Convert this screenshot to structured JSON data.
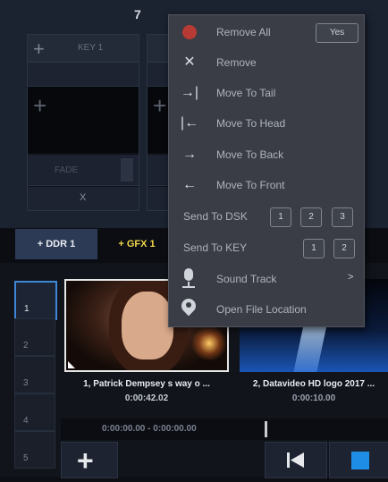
{
  "top": {
    "number": "7",
    "key_label": "KEY 1",
    "fade_label": "FADE",
    "x_label": "X"
  },
  "tabs": [
    {
      "label": "+ DDR 1"
    },
    {
      "label": "+ GFX 1"
    }
  ],
  "menu": {
    "remove_all": "Remove All",
    "yes": "Yes",
    "remove": "Remove",
    "move_to_tail": "Move To Tail",
    "move_to_head": "Move To Head",
    "move_to_back": "Move To Back",
    "move_to_front": "Move To Front",
    "send_to_dsk": "Send To DSK",
    "dsk_options": [
      "1",
      "2",
      "3"
    ],
    "send_to_key": "Send To KEY",
    "key_options": [
      "1",
      "2"
    ],
    "sound_track": "Sound Track",
    "sound_track_arrow": ">",
    "open_file_location": "Open File Location"
  },
  "playlist": {
    "slots": [
      "1",
      "2",
      "3",
      "4",
      "5"
    ],
    "items": [
      {
        "title": "1, Patrick Dempsey s way o ...",
        "duration": "0:00:42.02"
      },
      {
        "title": "2, Datavideo HD logo 2017 ...",
        "duration": "0:00:10.00"
      }
    ],
    "timecode": "0:00:00.00  -  0:00:00.00"
  },
  "colors": {
    "accent_blue": "#1e8de6",
    "tab_active": "#2c3a55",
    "gfx_yellow": "#f2d64b",
    "remove_all_red": "#b83a34"
  }
}
